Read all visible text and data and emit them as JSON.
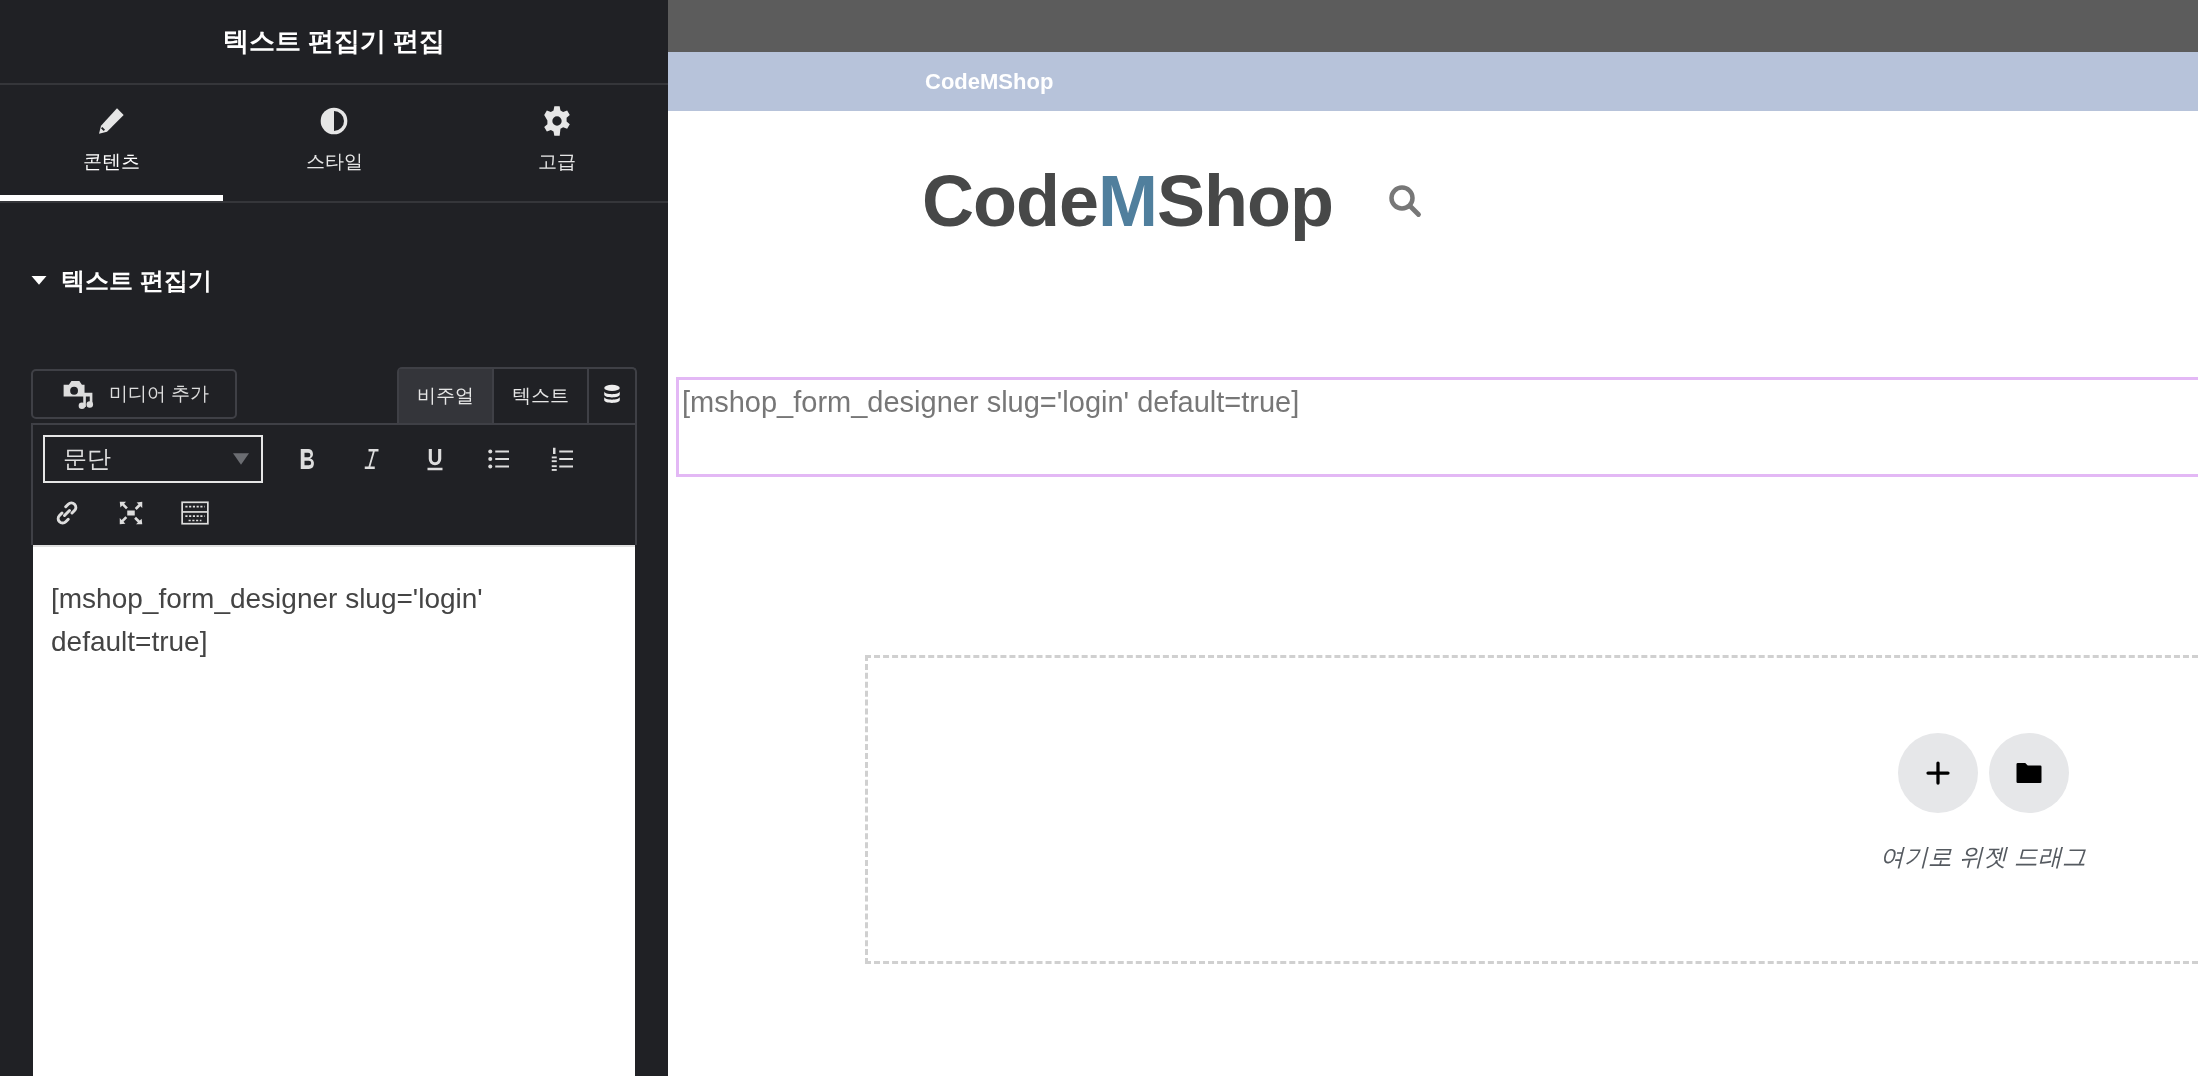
{
  "panel": {
    "title": "텍스트 편집기 편집",
    "tabs": [
      {
        "label": "콘텐츠",
        "selected": true
      },
      {
        "label": "스타일",
        "selected": false
      },
      {
        "label": "고급",
        "selected": false
      }
    ],
    "section": {
      "title": "텍스트 편집기",
      "expanded": true
    },
    "editor": {
      "media_button": "미디어 추가",
      "mode_tabs": [
        {
          "label": "비주얼",
          "selected": true
        },
        {
          "label": "텍스트",
          "selected": false
        }
      ],
      "format_select": "문단",
      "content": "[mshop_form_designer slug='login' default=true]"
    }
  },
  "canvas": {
    "banner": "CodeMShop",
    "logo": {
      "before": "Code",
      "accent": "M",
      "after": "Shop"
    },
    "shortcode_text": "[mshop_form_designer slug='login' default=true]",
    "drop_zone": {
      "hint": "여기로 위젯 드래그"
    }
  }
}
